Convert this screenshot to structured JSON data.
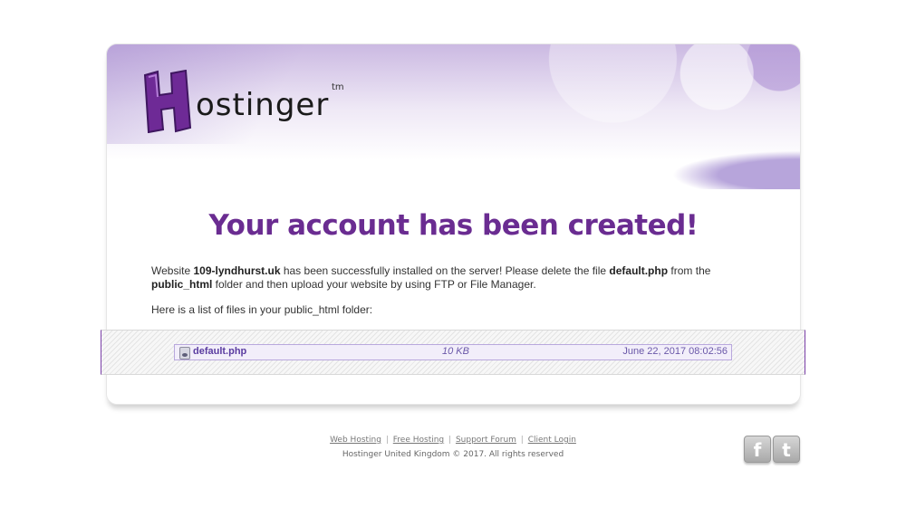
{
  "brand": {
    "logo_initial": "H",
    "logo_rest": "ostinger",
    "logo_tm": "tm",
    "accent": "#6a2c91"
  },
  "heading": "Your account has been created!",
  "message": {
    "p1_a": "Website ",
    "domain": "109-lyndhurst.uk",
    "p1_b": " has been successfully installed on the server! Please delete the file ",
    "file": "default.php",
    "p1_c": " from the ",
    "folder": "public_html",
    "p1_d": " folder and then upload your website by using FTP or File Manager.",
    "p2": "Here is a list of files in your public_html folder:"
  },
  "files": [
    {
      "icon": "php-file-icon",
      "name": "default.php",
      "size": "10 KB",
      "date": "June 22, 2017 08:02:56"
    }
  ],
  "footer": {
    "links": [
      "Web Hosting",
      "Free Hosting",
      "Support Forum",
      "Client Login"
    ],
    "separator": "|",
    "copyright": "Hostinger United Kingdom © 2017. All rights reserved"
  },
  "social": [
    {
      "icon": "facebook-icon",
      "glyph": "f"
    },
    {
      "icon": "twitter-icon",
      "glyph": "t"
    }
  ]
}
